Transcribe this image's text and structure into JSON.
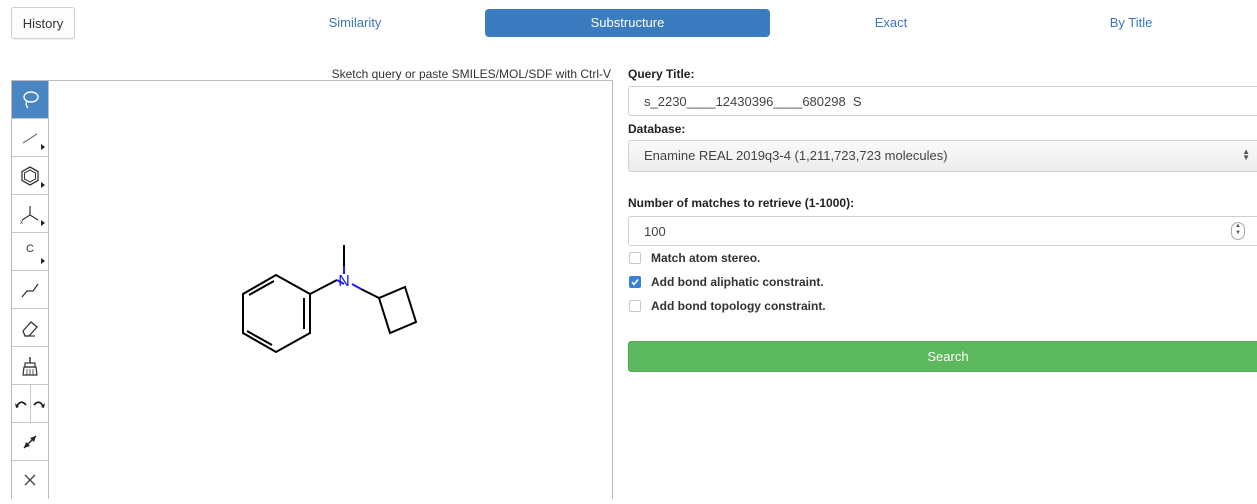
{
  "header": {
    "history_label": "History",
    "tabs": [
      {
        "label": "Similarity",
        "active": false
      },
      {
        "label": "Substructure",
        "active": true
      },
      {
        "label": "Exact",
        "active": false
      },
      {
        "label": "By Title",
        "active": false
      }
    ]
  },
  "sketcher": {
    "hint": "Sketch query or paste SMILES/MOL/SDF with Ctrl-V",
    "tools": [
      "lasso-select",
      "bond",
      "ring-template",
      "stereo-bond",
      "atom-element",
      "chain",
      "eraser",
      "clean-broom",
      "undo",
      "redo",
      "reaction-arrow",
      "clear"
    ],
    "atom_tool_label": "C",
    "molecule": {
      "atom_labels": [
        "N"
      ],
      "highlight_color": "#1a1aff"
    }
  },
  "form": {
    "query_title_label": "Query Title:",
    "query_title_value": "s_2230____12430396____680298  S",
    "database_label": "Database:",
    "database_value": "Enamine REAL 2019q3-4 (1,211,723,723 molecules)",
    "matches_label": "Number of matches to retrieve (1-1000):",
    "matches_value": "100",
    "options": [
      {
        "label": "Match atom stereo.",
        "checked": false
      },
      {
        "label": "Add bond aliphatic constraint.",
        "checked": true
      },
      {
        "label": "Add bond topology constraint.",
        "checked": false
      }
    ],
    "search_label": "Search"
  },
  "colors": {
    "accent": "#3a7cbf",
    "search_green": "#5cb85c",
    "checkbox_blue": "#3b7fd6"
  }
}
